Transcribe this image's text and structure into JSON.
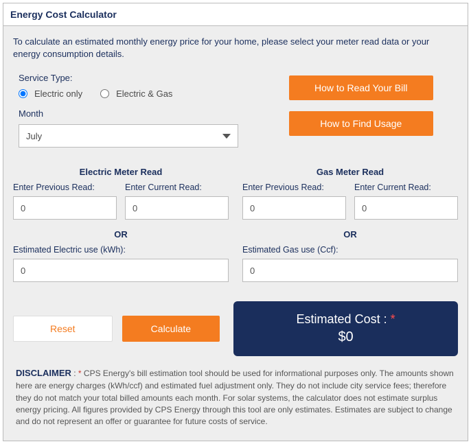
{
  "header": {
    "title": "Energy Cost Calculator"
  },
  "intro": "To calculate an estimated monthly energy price for your home, please select your meter read data or your energy consumption details.",
  "serviceType": {
    "label": "Service Type:",
    "options": {
      "electric": "Electric only",
      "both": "Electric & Gas"
    },
    "selected": "electric"
  },
  "month": {
    "label": "Month",
    "value": "July"
  },
  "helpButtons": {
    "bill": "How to Read Your Bill",
    "usage": "How to Find Usage"
  },
  "electric": {
    "title": "Electric Meter Read",
    "prevLabel": "Enter Previous Read:",
    "currLabel": "Enter Current Read:",
    "prevValue": "0",
    "currValue": "0",
    "or": "OR",
    "estLabel": "Estimated Electric use (kWh):",
    "estValue": "0"
  },
  "gas": {
    "title": "Gas Meter Read",
    "prevLabel": "Enter Previous Read:",
    "currLabel": "Enter Current Read:",
    "prevValue": "0",
    "currValue": "0",
    "or": "OR",
    "estLabel": "Estimated Gas use (Ccf):",
    "estValue": "0"
  },
  "actions": {
    "reset": "Reset",
    "calculate": "Calculate"
  },
  "result": {
    "label": "Estimated Cost : ",
    "star": "*",
    "value": "$0"
  },
  "disclaimer": {
    "title": "DISCLAIMER",
    "sep": " : ",
    "star": "*",
    "text": " CPS Energy's bill estimation tool should be used for informational purposes only. The amounts shown here are energy charges (kWh/ccf) and estimated fuel adjustment only. They do not include city service fees; therefore they do not match your total billed amounts each month. For solar systems, the calculator does not estimate surplus energy pricing. All figures provided by CPS Energy through this tool are only estimates. Estimates are subject to change and do not represent an offer or guarantee for future costs of service."
  }
}
